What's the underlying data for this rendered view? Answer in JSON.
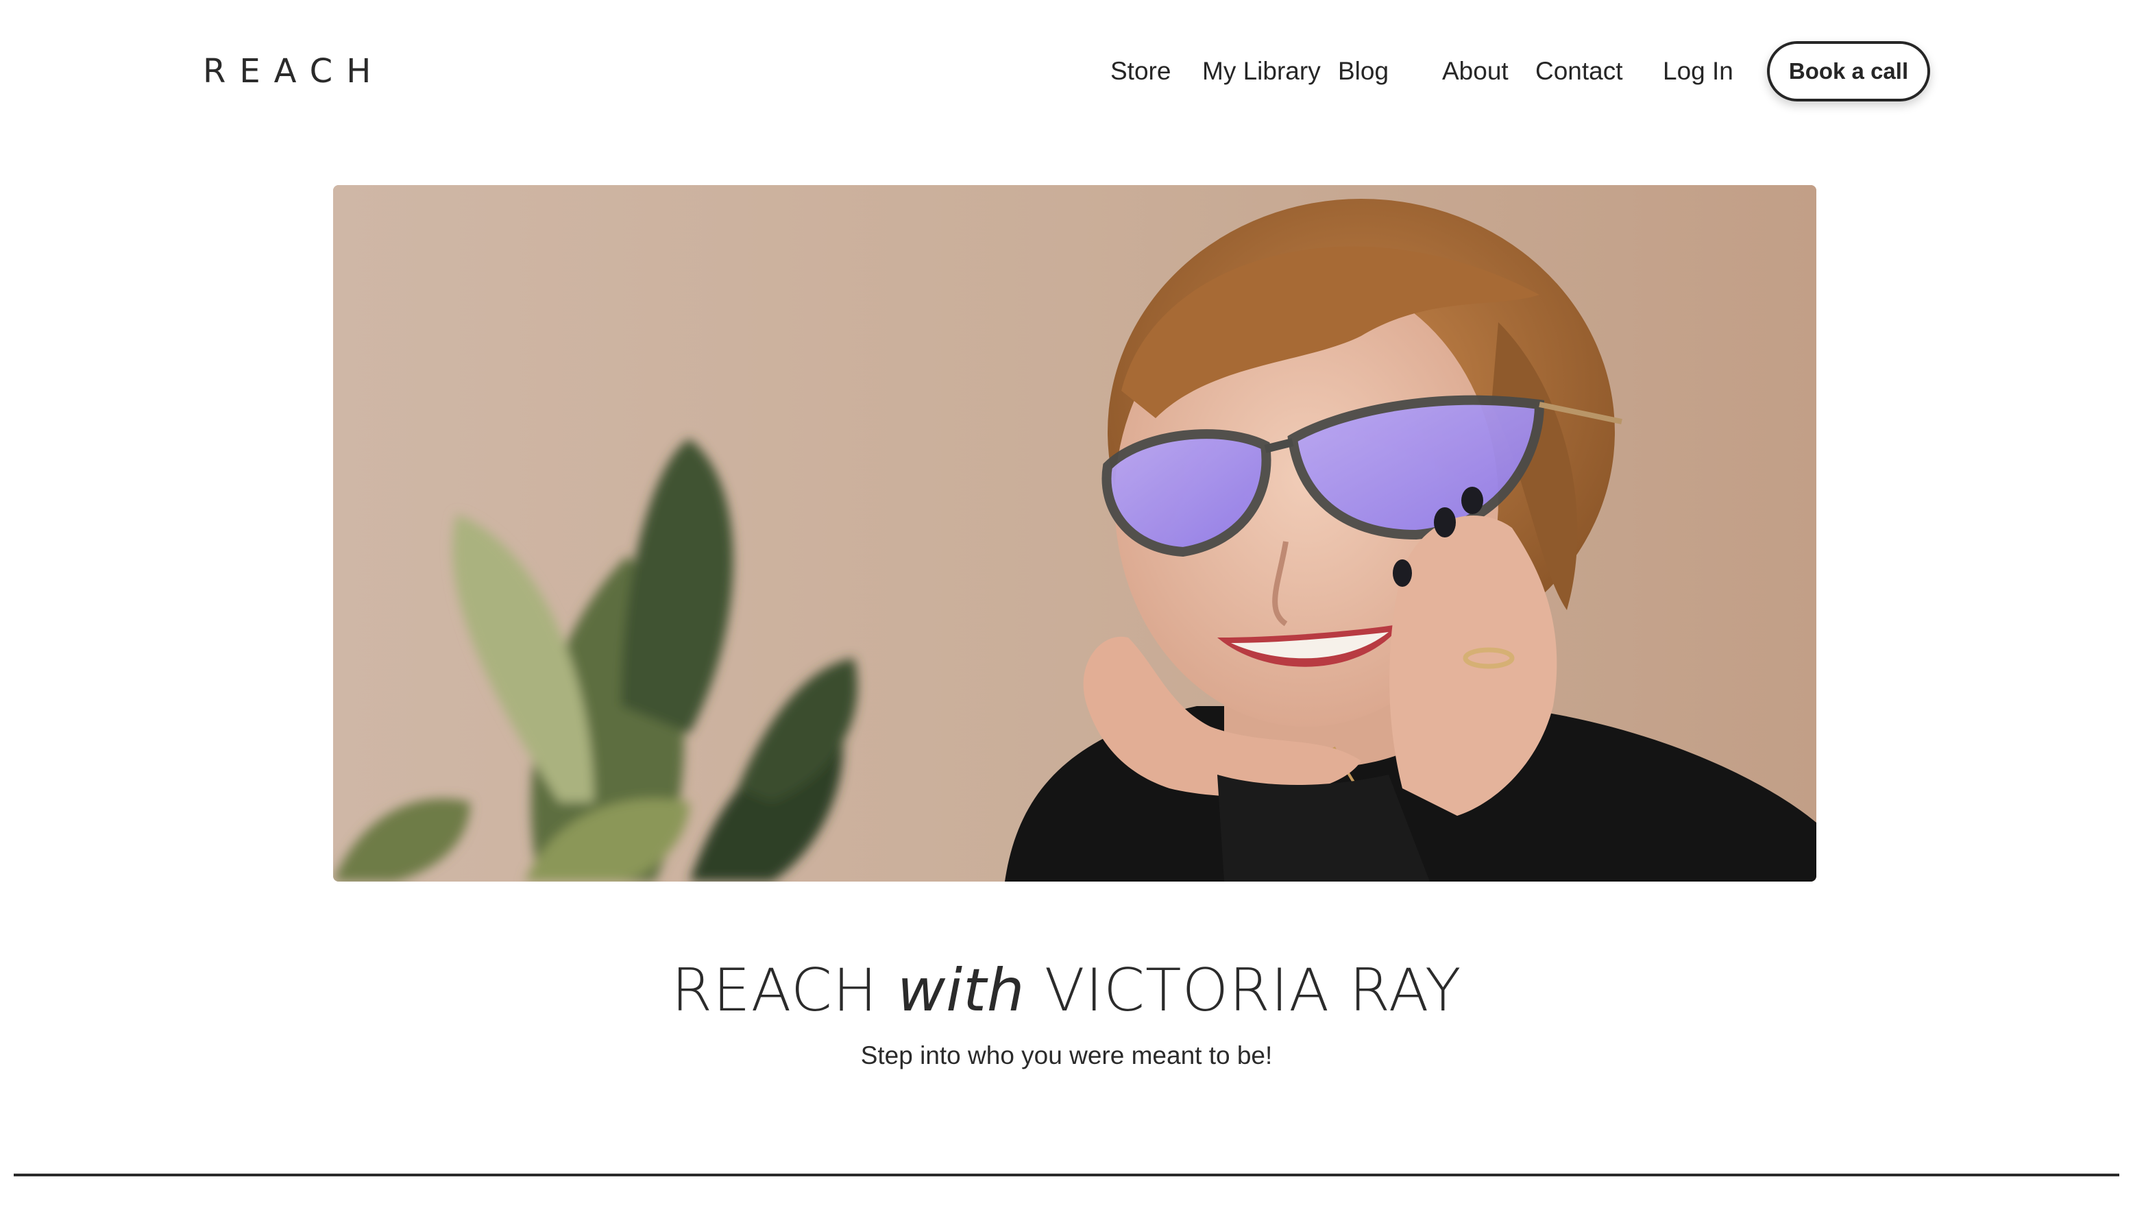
{
  "brand": {
    "logo_text": "REACH"
  },
  "nav": {
    "items": [
      {
        "label": "Store"
      },
      {
        "label": "My Library"
      },
      {
        "label": "Blog"
      },
      {
        "label": "About"
      },
      {
        "label": "Contact"
      },
      {
        "label": "Log In"
      }
    ],
    "cta_label": "Book a call"
  },
  "hero": {
    "image_icon": "portrait-photo-icon"
  },
  "headline": {
    "prefix": "REACH",
    "connector": "with",
    "name": "VICTORIA RAY",
    "tagline": "Step into who you were meant to be!"
  },
  "colors": {
    "text": "#262626",
    "background": "#ffffff",
    "hero_backdrop": "#c9ad98"
  }
}
